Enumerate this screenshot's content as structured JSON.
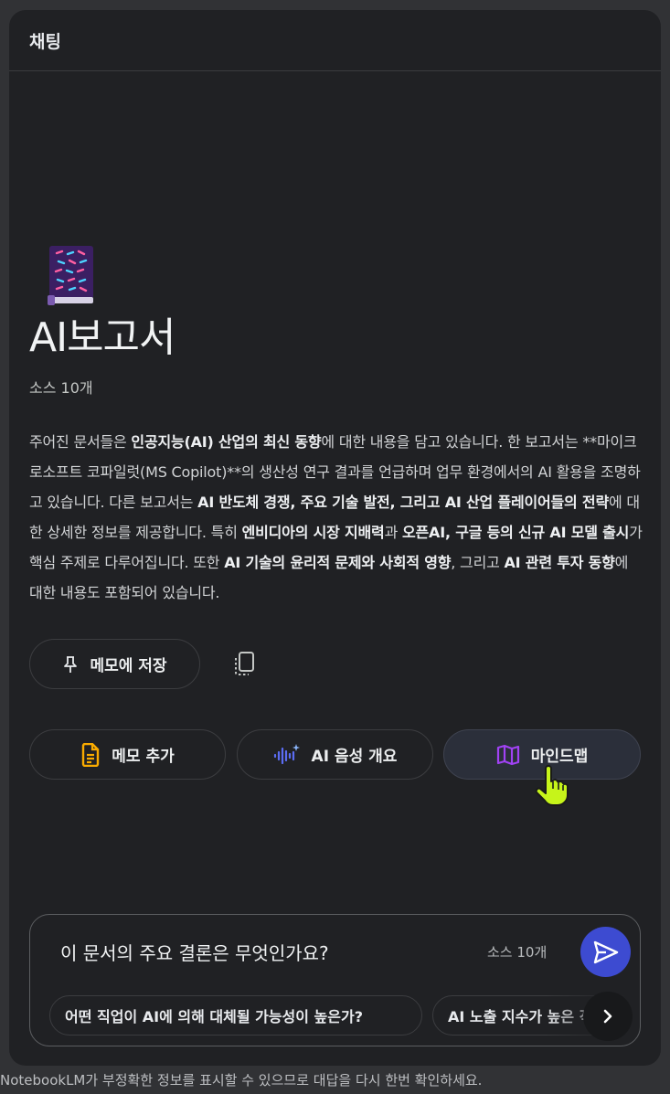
{
  "header": {
    "title": "채팅"
  },
  "notebook": {
    "emoji_icon": "notebook-book-icon",
    "title": "AI보고서",
    "sources_count": "소스 10개"
  },
  "summary": {
    "segments": [
      {
        "text": "주어진 문서들은 ",
        "bold": false
      },
      {
        "text": "인공지능(AI) 산업의 최신 동향",
        "bold": true
      },
      {
        "text": "에 대한 내용을 담고 있습니다. 한 보고서는 **마이크로소프트 코파일럿(MS Copilot)**의 생산성 연구 결과를 언급하며 업무 환경에서의 AI 활용을 조명하고 있습니다. 다른 보고서는 ",
        "bold": false
      },
      {
        "text": "AI 반도체 경쟁, 주요 기술 발전, 그리고 AI 산업 플레이어들의 전략",
        "bold": true
      },
      {
        "text": "에 대한 상세한 정보를 제공합니다. 특히 ",
        "bold": false
      },
      {
        "text": "엔비디아의 시장 지배력",
        "bold": true
      },
      {
        "text": "과 ",
        "bold": false
      },
      {
        "text": "오픈AI, 구글 등의 신규 AI 모델 출시",
        "bold": true
      },
      {
        "text": "가 핵심 주제로 다루어집니다. 또한 ",
        "bold": false
      },
      {
        "text": "AI 기술의 윤리적 문제와 사회적 영향",
        "bold": true
      },
      {
        "text": ", 그리고 ",
        "bold": false
      },
      {
        "text": "AI 관련 투자 동향",
        "bold": true
      },
      {
        "text": "에 대한 내용도 포함되어 있습니다.",
        "bold": false
      }
    ]
  },
  "actions": {
    "save_memo": "메모에 저장",
    "pin_icon": "pin-icon",
    "copy_icon": "copy-icon"
  },
  "studio_buttons": {
    "memo_add": "메모 추가",
    "audio_overview": "AI 음성 개요",
    "mindmap": "마인드맵"
  },
  "chat_input": {
    "value": "이 문서의 주요 결론은 무엇인가요?",
    "sources": "소스 10개",
    "send_icon": "send-icon"
  },
  "suggestions": [
    "어떤 직업이 AI에 의해 대체될 가능성이 높은가?",
    "AI 노출 지수가 높은 직업"
  ],
  "footer": {
    "disclaimer": "NotebookLM가 부정확한 정보를 표시할 수 있으므로 대답을 다시 한번 확인하세요."
  },
  "colors": {
    "panel_bg": "#202124",
    "page_bg": "#313235",
    "send_button": "#3d4bd1",
    "memo_icon": "#f9ab00",
    "audio_icon": "#5b6cf2",
    "mindmap_icon": "#a142f4",
    "cursor": "#c6f41a"
  }
}
